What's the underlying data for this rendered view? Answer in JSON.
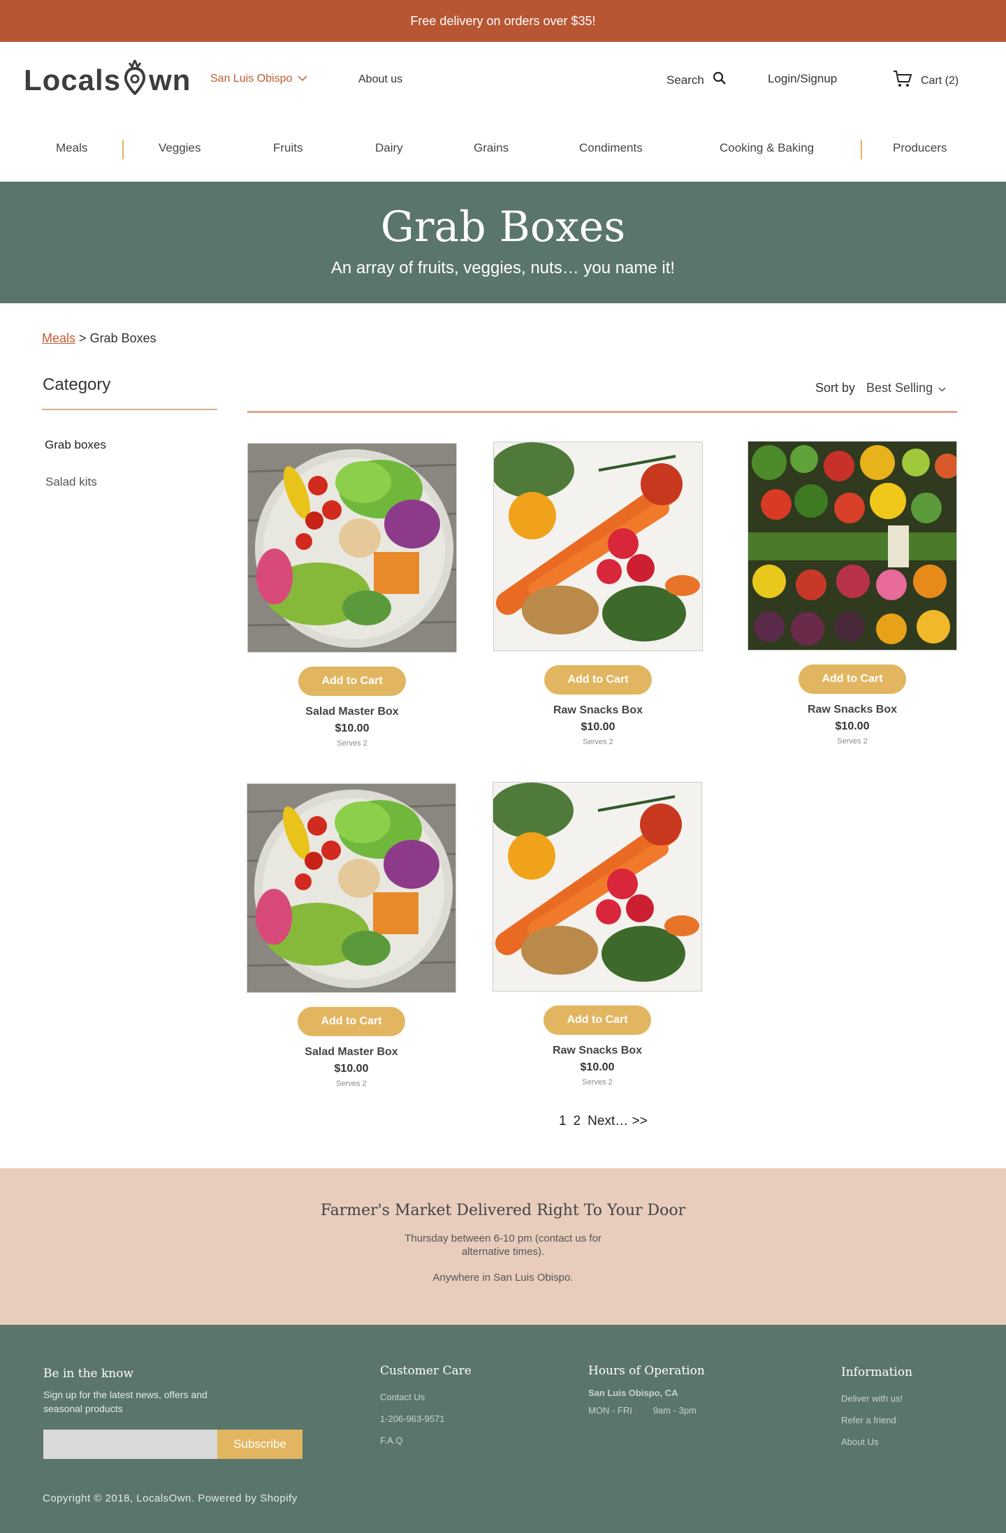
{
  "topbar": {
    "text": "Free delivery on orders over $35!"
  },
  "header": {
    "logo": "LocalsOwn",
    "logo_left": "Locals",
    "logo_right": "wn",
    "location": "San Luis Obispo",
    "about": "About us",
    "search": "Search",
    "login": "Login/Signup",
    "cart": "Cart (2)"
  },
  "categories": [
    "Meals",
    "Veggies",
    "Fruits",
    "Dairy",
    "Grains",
    "Condiments",
    "Cooking & Baking",
    "Producers"
  ],
  "hero": {
    "title": "Grab Boxes",
    "subtitle": "An array of fruits, veggies, nuts… you name it!"
  },
  "breadcrumb": {
    "parent": "Meals",
    "separator": ">",
    "current": "Grab Boxes"
  },
  "sidebar": {
    "title": "Category",
    "items": [
      "Grab boxes",
      "Salad kits"
    ]
  },
  "sort": {
    "label": "Sort by",
    "value": "Best Selling"
  },
  "products": [
    {
      "name": "Salad Master Box",
      "price": "$10.00",
      "serves": "Serves 2",
      "button": "Add to Cart",
      "image": "salad-bowl"
    },
    {
      "name": "Raw Snacks Box",
      "price": "$10.00",
      "serves": "Serves 2",
      "button": "Add to Cart",
      "image": "vegetables-berries"
    },
    {
      "name": "Raw Snacks Box",
      "price": "$10.00",
      "serves": "Serves 2",
      "button": "Add to Cart",
      "image": "market-produce"
    },
    {
      "name": "Salad Master Box",
      "price": "$10.00",
      "serves": "Serves 2",
      "button": "Add to Cart",
      "image": "salad-bowl"
    },
    {
      "name": "Raw Snacks Box",
      "price": "$10.00",
      "serves": "Serves 2",
      "button": "Add to Cart",
      "image": "vegetables-berries"
    }
  ],
  "pagination": {
    "page1": "1",
    "page2": "2",
    "next": "Next… >>"
  },
  "promo": {
    "title": "Farmer's Market Delivered Right To Your Door",
    "line1": "Thursday between 6-10 pm (contact us for alternative times).",
    "line2": "Anywhere in San Luis Obispo."
  },
  "footer": {
    "newsletter": {
      "title": "Be in the know",
      "desc": "Sign up for the latest news, offers and seasonal products",
      "placeholder": "",
      "button": "Subscribe"
    },
    "care": {
      "title": "Customer Care",
      "links": [
        "Contact Us",
        "1-206-963-9571",
        "F.A.Q"
      ]
    },
    "hours": {
      "title": "Hours of Operation",
      "location": "San Luis Obispo, CA",
      "days": "MON - FRI",
      "time": "9am - 3pm"
    },
    "info": {
      "title": "Information",
      "links": [
        "Deliver with us!",
        "Refer a friend",
        "About Us"
      ]
    },
    "copyright": "Copyright © 2018, LocalsOwn. Powered by Shopify"
  },
  "colors": {
    "accent": "#b85532",
    "gold": "#e2b560",
    "green": "#5a756b",
    "peach": "#e8cdbc"
  }
}
